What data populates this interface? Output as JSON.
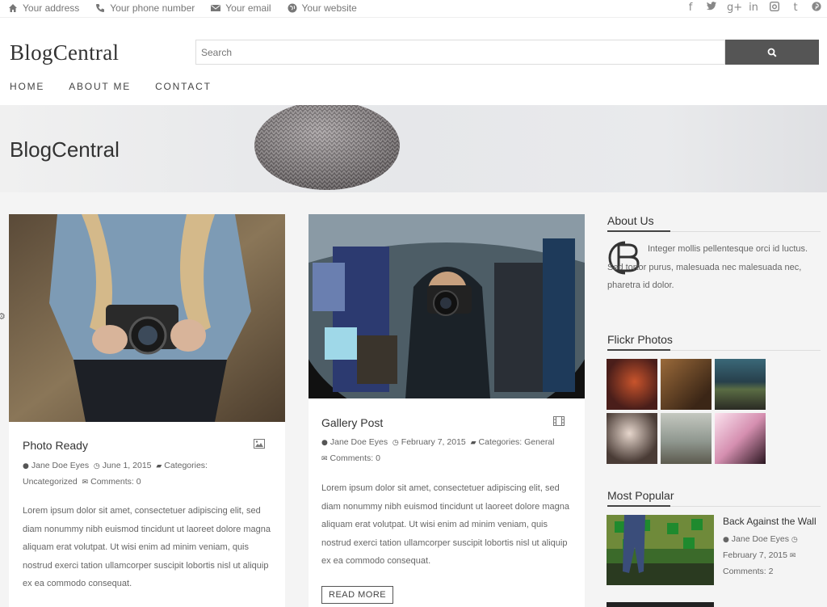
{
  "topbar": {
    "address": "Your address",
    "phone": "Your phone number",
    "email": "Your email",
    "website": "Your website",
    "social": [
      "f",
      "⨯",
      "g+",
      "in",
      "▣",
      "t",
      "℗"
    ]
  },
  "header": {
    "logo": "BlogCentral",
    "search_placeholder": "Search",
    "nav": [
      "HOME",
      "ABOUT ME",
      "CONTACT"
    ]
  },
  "hero": {
    "title": "BlogCentral"
  },
  "posts": [
    {
      "title": "Photo Ready",
      "author": "Jane Doe Eyes",
      "date": "June 1, 2015",
      "categories": "Categories:",
      "category": "Uncategorized",
      "comments": "Comments: 0",
      "excerpt": "Lorem ipsum dolor sit amet, consectetuer adipiscing elit, sed diam nonummy nibh euismod tincidunt ut laoreet dolore magna aliquam erat volutpat. Ut wisi enim ad minim veniam, quis nostrud exerci tation ullamcorper suscipit lobortis nisl ut aliquip ex ea commodo consequat."
    },
    {
      "title": "Gallery Post",
      "author": "Jane Doe Eyes",
      "date": "February 7, 2015",
      "categories": "Categories: General",
      "comments": "Comments: 0",
      "excerpt": "Lorem ipsum dolor sit amet, consectetuer adipiscing elit, sed diam nonummy nibh euismod tincidunt ut laoreet dolore magna aliquam erat volutpat. Ut wisi enim ad minim veniam, quis nostrud exerci tation ullamcorper suscipit lobortis nisl ut aliquip ex ea commodo consequat.",
      "read_more": "READ MORE"
    }
  ],
  "sidebar": {
    "about_title": "About Us",
    "about_text": "Integer mollis pellentesque orci id luctus. Sed tortor purus, malesuada nec malesuada nec, pharetra id dolor.",
    "flickr_title": "Flickr Photos",
    "popular_title": "Most Popular",
    "popular": {
      "title": "Back Against the Wall",
      "author": "Jane Doe Eyes",
      "date": "February 7, 2015",
      "comments": "Comments: 2"
    }
  },
  "colors": {
    "accent": "#555555",
    "background": "#f4f4f4"
  }
}
